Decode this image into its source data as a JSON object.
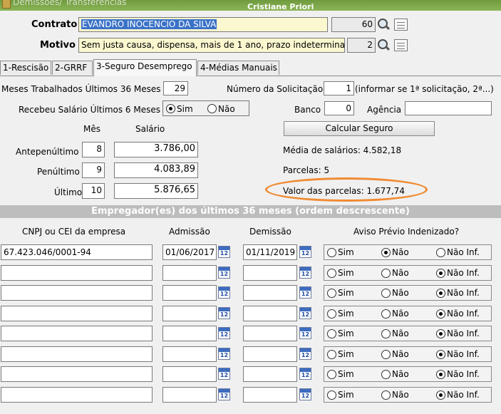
{
  "window": {
    "title": "Demissões/ Transferências",
    "user": "Cristiane Priori"
  },
  "header": {
    "contrato_label": "Contrato",
    "contrato_value": "EVANDRO INOCENCIO DA SILVA",
    "contrato_code": "60",
    "motivo_label": "Motivo",
    "motivo_value": "Sem justa causa, dispensa, mais de 1 ano, prazo indetermina",
    "motivo_code": "2"
  },
  "tabs": [
    {
      "label": "1-Rescisão"
    },
    {
      "label": "2-GRRF"
    },
    {
      "label": "3-Seguro Desemprego"
    },
    {
      "label": "4-Médias Manuais"
    }
  ],
  "seguro": {
    "meses_label": "Meses Trabalhados Últimos 36 Meses",
    "meses_value": "29",
    "num_solic_label": "Número da Solicitação",
    "num_solic_value": "1",
    "num_solic_hint": "(informar se 1ª solicitação, 2ª...)",
    "recebeu_label": "Recebeu Salário Últimos 6 Meses",
    "sim_label": "Sim",
    "nao_label": "Não",
    "banco_label": "Banco",
    "banco_value": "0",
    "agencia_label": "Agência",
    "agencia_value": "",
    "mes_header": "Mês",
    "salario_header": "Salário",
    "rows": [
      {
        "label": "Antepenúltimo",
        "mes": "8",
        "salario": "3.786,00"
      },
      {
        "label": "Penúltimo",
        "mes": "9",
        "salario": "4.083,89"
      },
      {
        "label": "Último",
        "mes": "10",
        "salario": "5.876,65"
      }
    ],
    "calc_button": "Calcular Seguro",
    "media_text": "Média de salários:  4.582,18",
    "parcelas_text": "Parcelas:  5",
    "valor_text": "Valor das parcelas:  1.677,74"
  },
  "empregadores": {
    "banner": "Empregador(es) dos últimos 36 meses (ordem descrescente)",
    "col_cnpj": "CNPJ ou CEI da empresa",
    "col_admissao": "Admissão",
    "col_demissao": "Demissão",
    "col_aviso": "Aviso Prévio Indenizado?",
    "opt_sim": "Sim",
    "opt_nao": "Não",
    "opt_naoinf": "Não Inf.",
    "cal_icon_text": "12",
    "rows": [
      {
        "cnpj": "67.423.046/0001-94",
        "admissao": "01/06/2017",
        "demissao": "01/11/2019",
        "aviso": "nao"
      },
      {
        "cnpj": "",
        "admissao": "",
        "demissao": "",
        "aviso": "naoinf"
      },
      {
        "cnpj": "",
        "admissao": "",
        "demissao": "",
        "aviso": "naoinf"
      },
      {
        "cnpj": "",
        "admissao": "",
        "demissao": "",
        "aviso": "naoinf"
      },
      {
        "cnpj": "",
        "admissao": "",
        "demissao": "",
        "aviso": "naoinf"
      },
      {
        "cnpj": "",
        "admissao": "",
        "demissao": "",
        "aviso": "naoinf"
      },
      {
        "cnpj": "",
        "admissao": "",
        "demissao": "",
        "aviso": "naoinf"
      },
      {
        "cnpj": "",
        "admissao": "",
        "demissao": "",
        "aviso": "naoinf"
      }
    ]
  },
  "icons": {
    "search": "magnifier-icon",
    "list": "list-icon",
    "calendar": "calendar-icon"
  }
}
